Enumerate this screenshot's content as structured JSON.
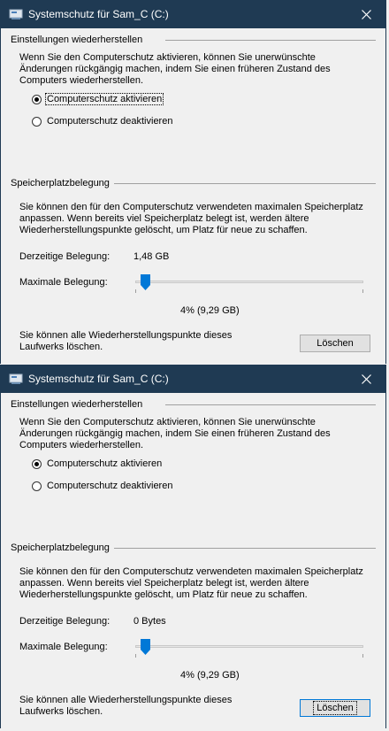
{
  "dialogs": [
    {
      "title": "Systemschutz für Sam_C (C:)",
      "restore_group_title": "Einstellungen wiederherstellen",
      "restore_text": "Wenn Sie den Computerschutz aktivieren, können Sie unerwünschte Änderungen rückgängig machen, indem Sie einen früheren Zustand des Computers wiederherstellen.",
      "radio_enable": "Computerschutz aktivieren",
      "radio_disable": "Computerschutz deaktivieren",
      "selected": "enable",
      "disk_group_title": "Speicherplatzbelegung",
      "disk_text": "Sie können den für den Computerschutz verwendeten maximalen Speicherplatz anpassen. Wenn bereits viel Speicherplatz belegt ist, werden ältere Wiederherstellungspunkte gelöscht, um Platz für neue zu schaffen.",
      "current_usage_label": "Derzeitige Belegung:",
      "current_usage_value": "1,48 GB",
      "max_usage_label": "Maximale Belegung:",
      "slider_percent": 4,
      "slider_value_text": "4% (9,29 GB)",
      "delete_text": "Sie können alle Wiederherstellungspunkte dieses Laufwerks löschen.",
      "delete_button": "Löschen"
    },
    {
      "title": "Systemschutz für Sam_C (C:)",
      "restore_group_title": "Einstellungen wiederherstellen",
      "restore_text": "Wenn Sie den Computerschutz aktivieren, können Sie unerwünschte Änderungen rückgängig machen, indem Sie einen früheren Zustand des Computers wiederherstellen.",
      "radio_enable": "Computerschutz aktivieren",
      "radio_disable": "Computerschutz deaktivieren",
      "selected": "enable",
      "disk_group_title": "Speicherplatzbelegung",
      "disk_text": "Sie können den für den Computerschutz verwendeten maximalen Speicherplatz anpassen. Wenn bereits viel Speicherplatz belegt ist, werden ältere Wiederherstellungspunkte gelöscht, um Platz für neue zu schaffen.",
      "current_usage_label": "Derzeitige Belegung:",
      "current_usage_value": "0 Bytes",
      "max_usage_label": "Maximale Belegung:",
      "slider_percent": 4,
      "slider_value_text": "4% (9,29 GB)",
      "delete_text": "Sie können alle Wiederherstellungspunkte dieses Laufwerks löschen.",
      "delete_button": "Löschen"
    }
  ],
  "icons": {
    "title_icon": "drive-icon",
    "close_icon": "close-icon",
    "thumb_icon": "slider-thumb"
  },
  "colors": {
    "titlebar": "#1f3a53",
    "dialog_bg": "#f0f0f0",
    "focus_border": "#0078d7"
  }
}
